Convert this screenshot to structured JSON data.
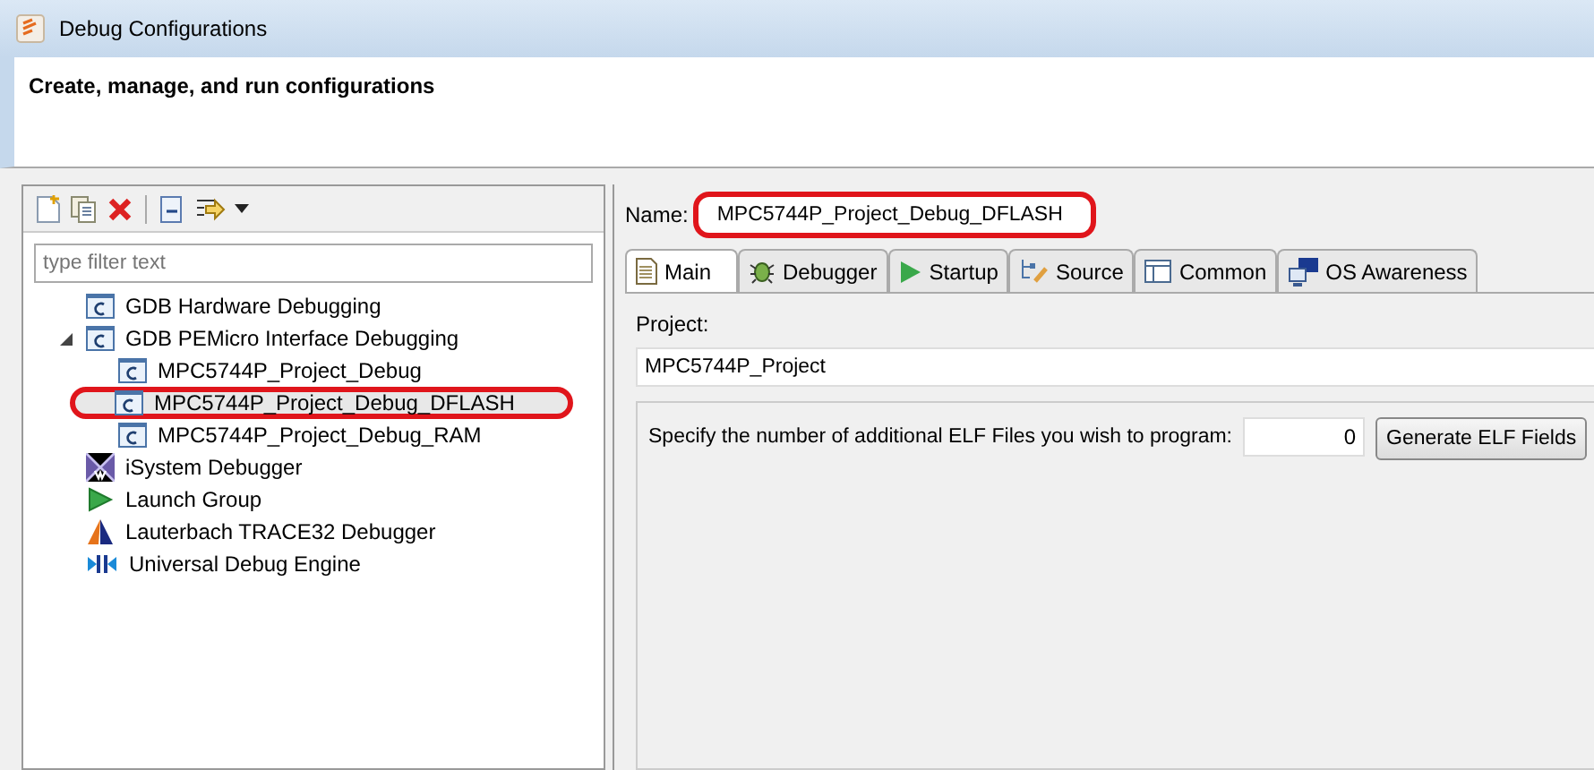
{
  "window": {
    "title": "Debug Configurations"
  },
  "header": {
    "title": "Create, manage, and run configurations"
  },
  "sidebar": {
    "filter": {
      "placeholder": "type filter text"
    },
    "items": [
      {
        "label": "GDB Hardware Debugging",
        "kind": "c",
        "selected": false,
        "highlighted": false
      },
      {
        "label": "GDB PEMicro Interface Debugging",
        "kind": "c",
        "selected": false,
        "highlighted": false,
        "expanded": true,
        "children": [
          {
            "label": "MPC5744P_Project_Debug",
            "kind": "c",
            "selected": false,
            "highlighted": false
          },
          {
            "label": "MPC5744P_Project_Debug_DFLASH",
            "kind": "c",
            "selected": true,
            "highlighted": true
          },
          {
            "label": "MPC5744P_Project_Debug_RAM",
            "kind": "c",
            "selected": false,
            "highlighted": false
          }
        ]
      },
      {
        "label": "iSystem Debugger",
        "kind": "isystem",
        "selected": false,
        "highlighted": false
      },
      {
        "label": "Launch Group",
        "kind": "launch",
        "selected": false,
        "highlighted": false
      },
      {
        "label": "Lauterbach TRACE32 Debugger",
        "kind": "lauterbach",
        "selected": false,
        "highlighted": false
      },
      {
        "label": "Universal Debug Engine",
        "kind": "ude",
        "selected": false,
        "highlighted": false
      }
    ]
  },
  "name_field": {
    "label": "Name:",
    "value": "MPC5744P_Project_Debug_DFLASH",
    "highlighted": true
  },
  "tabs": [
    {
      "label": "Main",
      "kind": "main",
      "selected": true
    },
    {
      "label": "Debugger",
      "kind": "debugger",
      "selected": false
    },
    {
      "label": "Startup",
      "kind": "startup",
      "selected": false
    },
    {
      "label": "Source",
      "kind": "source",
      "selected": false
    },
    {
      "label": "Common",
      "kind": "common",
      "selected": false
    },
    {
      "label": "OS Awareness",
      "kind": "os",
      "selected": false
    }
  ],
  "main": {
    "project_label": "Project:",
    "project_value": "MPC5744P_Project",
    "elf_label": "Specify the number of additional ELF Files you wish to program:",
    "elf_count": "0",
    "generate_button": "Generate ELF Fields"
  }
}
